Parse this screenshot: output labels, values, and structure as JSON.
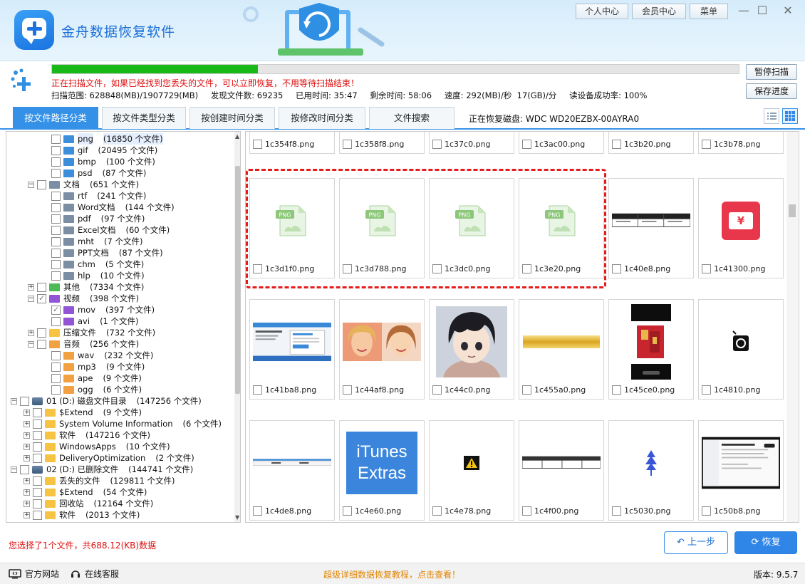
{
  "app": {
    "title": "金舟数据恢复软件",
    "top_buttons": [
      "个人中心",
      "会员中心",
      "菜单"
    ]
  },
  "scan": {
    "progress": 0.3,
    "warning": "正在扫描文件，如果已经找到您丢失的文件，可以立即恢复，不用等待扫描结束！",
    "range": "扫描范围: 628848(MB)/1907729(MB)",
    "found": "发现文件数: 69235",
    "elapsed": "已用时间: 35:47",
    "remaining": "剩余时间: 58:06",
    "speed": "速度: 292(MB)/秒  17(GB)/分",
    "read_rate": "读设备成功率: 100%",
    "pause_label": "暂停扫描",
    "save_label": "保存进度"
  },
  "tabs": [
    "按文件路径分类",
    "按文件类型分类",
    "按创建时间分类",
    "按修改时间分类",
    "文件搜索"
  ],
  "recovering_disk": "正在恢复磁盘: WDC WD20EZBX-00AYRA0",
  "tree": [
    {
      "indent": 3,
      "exp": "",
      "icon": "blue",
      "label": "png",
      "count": "(16850 个文件)",
      "hl": true
    },
    {
      "indent": 3,
      "exp": "",
      "icon": "blue",
      "label": "gif",
      "count": "(20495 个文件)"
    },
    {
      "indent": 3,
      "exp": "",
      "icon": "blue",
      "label": "bmp",
      "count": "(100 个文件)"
    },
    {
      "indent": 3,
      "exp": "",
      "icon": "blue",
      "label": "psd",
      "count": "(87 个文件)"
    },
    {
      "indent": 2,
      "exp": "−",
      "icon": "gray",
      "label": "文档",
      "count": "(651 个文件)"
    },
    {
      "indent": 3,
      "exp": "",
      "icon": "gray",
      "label": "rtf",
      "count": "(241 个文件)"
    },
    {
      "indent": 3,
      "exp": "",
      "icon": "gray",
      "label": "Word文档",
      "count": "(144 个文件)"
    },
    {
      "indent": 3,
      "exp": "",
      "icon": "gray",
      "label": "pdf",
      "count": "(97 个文件)"
    },
    {
      "indent": 3,
      "exp": "",
      "icon": "gray",
      "label": "Excel文档",
      "count": "(60 个文件)"
    },
    {
      "indent": 3,
      "exp": "",
      "icon": "gray",
      "label": "mht",
      "count": "(7 个文件)"
    },
    {
      "indent": 3,
      "exp": "",
      "icon": "gray",
      "label": "PPT文档",
      "count": "(87 个文件)"
    },
    {
      "indent": 3,
      "exp": "",
      "icon": "gray",
      "label": "chm",
      "count": "(5 个文件)"
    },
    {
      "indent": 3,
      "exp": "",
      "icon": "gray",
      "label": "hlp",
      "count": "(10 个文件)"
    },
    {
      "indent": 2,
      "exp": "+",
      "icon": "green",
      "label": "其他",
      "count": "(7334 个文件)"
    },
    {
      "indent": 2,
      "exp": "−",
      "icon": "purple",
      "label": "视频",
      "count": "(398 个文件)",
      "partial": true
    },
    {
      "indent": 3,
      "exp": "",
      "icon": "purple",
      "label": "mov",
      "count": "(397 个文件)",
      "partial": true
    },
    {
      "indent": 3,
      "exp": "",
      "icon": "purple",
      "label": "avi",
      "count": "(1 个文件)"
    },
    {
      "indent": 2,
      "exp": "+",
      "icon": "yellow",
      "label": "压缩文件",
      "count": "(732 个文件)"
    },
    {
      "indent": 2,
      "exp": "−",
      "icon": "orange",
      "label": "音频",
      "count": "(256 个文件)"
    },
    {
      "indent": 3,
      "exp": "",
      "icon": "orange",
      "label": "wav",
      "count": "(232 个文件)"
    },
    {
      "indent": 3,
      "exp": "",
      "icon": "orange",
      "label": "mp3",
      "count": "(9 个文件)"
    },
    {
      "indent": 3,
      "exp": "",
      "icon": "orange",
      "label": "ape",
      "count": "(9 个文件)"
    },
    {
      "indent": 3,
      "exp": "",
      "icon": "orange",
      "label": "ogg",
      "count": "(6 个文件)"
    },
    {
      "indent": 0,
      "exp": "−",
      "icon": "disk",
      "label": "01 (D:) 磁盘文件目录",
      "count": "(147256 个文件)"
    },
    {
      "indent": 1,
      "exp": "+",
      "icon": "yellow",
      "label": "$Extend",
      "count": "(9 个文件)"
    },
    {
      "indent": 1,
      "exp": "+",
      "icon": "yellow",
      "label": "System Volume Information",
      "count": "(6 个文件)"
    },
    {
      "indent": 1,
      "exp": "+",
      "icon": "yellow",
      "label": "软件",
      "count": "(147216 个文件)"
    },
    {
      "indent": 1,
      "exp": "+",
      "icon": "yellow",
      "label": "WindowsApps",
      "count": "(10 个文件)"
    },
    {
      "indent": 1,
      "exp": "+",
      "icon": "yellow",
      "label": "DeliveryOptimization",
      "count": "(2 个文件)"
    },
    {
      "indent": 0,
      "exp": "−",
      "icon": "disk",
      "label": "02 (D:) 已删除文件",
      "count": "(144741 个文件)"
    },
    {
      "indent": 1,
      "exp": "+",
      "icon": "yellow",
      "label": "丢失的文件",
      "count": "(129811 个文件)"
    },
    {
      "indent": 1,
      "exp": "+",
      "icon": "yellow",
      "label": "$Extend",
      "count": "(54 个文件)"
    },
    {
      "indent": 1,
      "exp": "+",
      "icon": "yellow",
      "label": "回收站",
      "count": "(12164 个文件)"
    },
    {
      "indent": 1,
      "exp": "+",
      "icon": "yellow",
      "label": "软件",
      "count": "(2013 个文件)"
    }
  ],
  "files": [
    {
      "name": "1c354f8.png",
      "thumb": "cut-bottom"
    },
    {
      "name": "1c358f8.png",
      "thumb": "cut-bottom"
    },
    {
      "name": "1c37c0.png",
      "thumb": "cut-bottom"
    },
    {
      "name": "1c3ac00.png",
      "thumb": "cut-bottom"
    },
    {
      "name": "1c3b20.png",
      "thumb": "cut-bottom"
    },
    {
      "name": "1c3b78.png",
      "thumb": "cut-dark"
    },
    {
      "name": "1c3d1f0.png",
      "thumb": "png-placeholder"
    },
    {
      "name": "1c3d788.png",
      "thumb": "png-placeholder"
    },
    {
      "name": "1c3dc0.png",
      "thumb": "png-placeholder"
    },
    {
      "name": "1c3e20.png",
      "thumb": "png-placeholder"
    },
    {
      "name": "1c40e8.png",
      "thumb": "table-strip"
    },
    {
      "name": "1c41300.png",
      "thumb": "red-ticket"
    },
    {
      "name": "1c41ba8.png",
      "thumb": "webpage"
    },
    {
      "name": "1c44af8.png",
      "thumb": "portraits"
    },
    {
      "name": "1c44c0.png",
      "thumb": "anime"
    },
    {
      "name": "1c455a0.png",
      "thumb": "gold-bar"
    },
    {
      "name": "1c45ce0.png",
      "thumb": "phone-red"
    },
    {
      "name": "1c4810.png",
      "thumb": "dark-icon"
    },
    {
      "name": "1c4de8.png",
      "thumb": "thin-bar"
    },
    {
      "name": "1c4e60.png",
      "thumb": "itunes"
    },
    {
      "name": "1c4e78.png",
      "thumb": "warning"
    },
    {
      "name": "1c4f00.png",
      "thumb": "table-strip2"
    },
    {
      "name": "1c5030.png",
      "thumb": "blue-figure"
    },
    {
      "name": "1c50b8.png",
      "thumb": "screenshot"
    }
  ],
  "thumb_text": {
    "png": "PNG",
    "itunes_line1": "iTunes",
    "itunes_line2": "Extras",
    "ticket_glyph": "¥"
  },
  "bottom": {
    "selected_info": "您选择了1个文件，共688.12(KB)数据",
    "prev": "上一步",
    "recover": "恢复",
    "site": "官方网站",
    "support": "在线客服",
    "tutorial": "超级详细数据恢复教程，点击查看！",
    "version": "版本: 9.5.7"
  },
  "colors": {
    "accent": "#3591e8",
    "progress": "#18b918",
    "warning": "#e01010",
    "selection": "#e41c1c"
  }
}
